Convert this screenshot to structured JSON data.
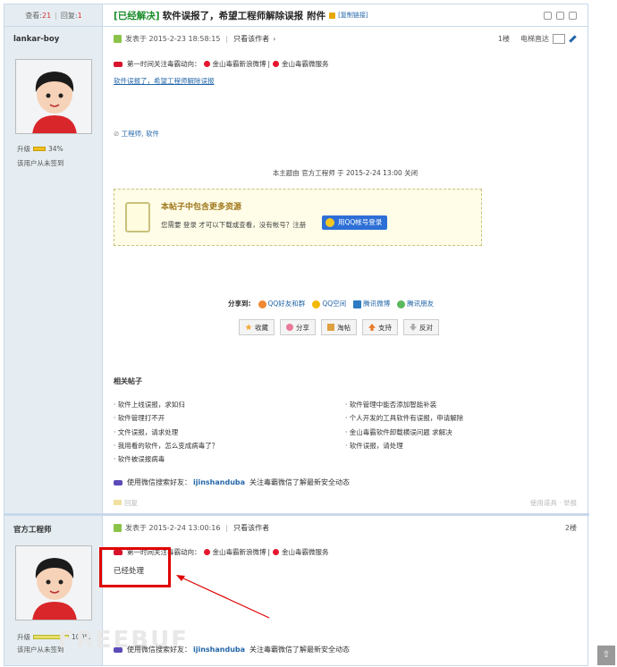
{
  "header": {
    "stats_view_label": "查看:",
    "views": "21",
    "stats_sep": "|",
    "stats_reply_label": "回复:",
    "replies": "1",
    "solved_tag": "[已经解决]",
    "title": "软件误报了，希望工程师解除误报",
    "attachment": "附件",
    "copy_link": "[复制链接]"
  },
  "post1": {
    "author": "lankar-boy",
    "level_label": "升级",
    "level_percent": "34%",
    "sign_status": "该用户从未签到",
    "posted_at": "发表于 2015-2-23 18:58:15",
    "sep": "|",
    "only_author": "只看该作者",
    "floor": "1楼",
    "elevator": "电梯直达",
    "weibo_prefix": "第一时间关注毒霸动向：",
    "weibo_link1": "金山毒霸新浪微博",
    "weibo_sep": "|",
    "weibo_link2": "金山毒霸微服务",
    "body_text": "软件误报了，希望工程师解除误报",
    "tags": "工程师, 软件",
    "closed_note": "本主题由 官方工程师 于 2015-2-24 13:00 关闭",
    "resource_title": "本帖子中包含更多资源",
    "resource_text": "您需要 登录 才可以下载或查看，没有帐号？注册",
    "qq_login": "用QQ帐号登录",
    "share_label": "分享到:",
    "share_items": [
      "QQ好友和群",
      "QQ空间",
      "腾讯微博",
      "腾讯朋友"
    ],
    "actions": [
      "收藏",
      "分享",
      "淘帖",
      "支持",
      "反对"
    ],
    "related_title": "相关帖子",
    "related_left": [
      "软件上线误报，求如归",
      "软件管理打不开",
      "文件误报，请求处理",
      "我用看的软件，怎么变成病毒了？",
      "软件被误报病毒"
    ],
    "related_right": [
      "软件管理中能否添加智能补装",
      "个人开发的工具软件有误报，申请解除",
      "金山毒霸软件卸载横误问题 求解决",
      "软件误报，请处理"
    ],
    "wechat_prefix": "使用微信搜索好友：",
    "wechat_id": "ijinshanduba",
    "wechat_suffix": "关注毒霸微信了解最新安全动态",
    "reply_tool": "回复",
    "tools_right": "使用道具 · 举报"
  },
  "post2": {
    "author": "官方工程师",
    "level_label": "升级",
    "level_percent": "100%",
    "sign_status": "该用户从未签到",
    "posted_at": "发表于 2015-2-24 13:00:16",
    "sep": "|",
    "only_author": "只看该作者",
    "floor": "2楼",
    "weibo_prefix": "第一时间关注毒霸动向：",
    "weibo_link1": "金山毒霸新浪微博",
    "weibo_sep": "|",
    "weibo_link2": "金山毒霸微服务",
    "body_text": "已经处理",
    "wechat_prefix": "使用微信搜索好友：",
    "wechat_id": "ijinshanduba",
    "wechat_suffix": "关注毒霸微信了解最新安全动态"
  },
  "watermark": "FREEBUF",
  "scroll_top": "⇧",
  "colors": {
    "accent": "#2366a8",
    "solved": "#1a8c2a",
    "annotation": "#e00000",
    "sidebar": "#e5edf2"
  }
}
